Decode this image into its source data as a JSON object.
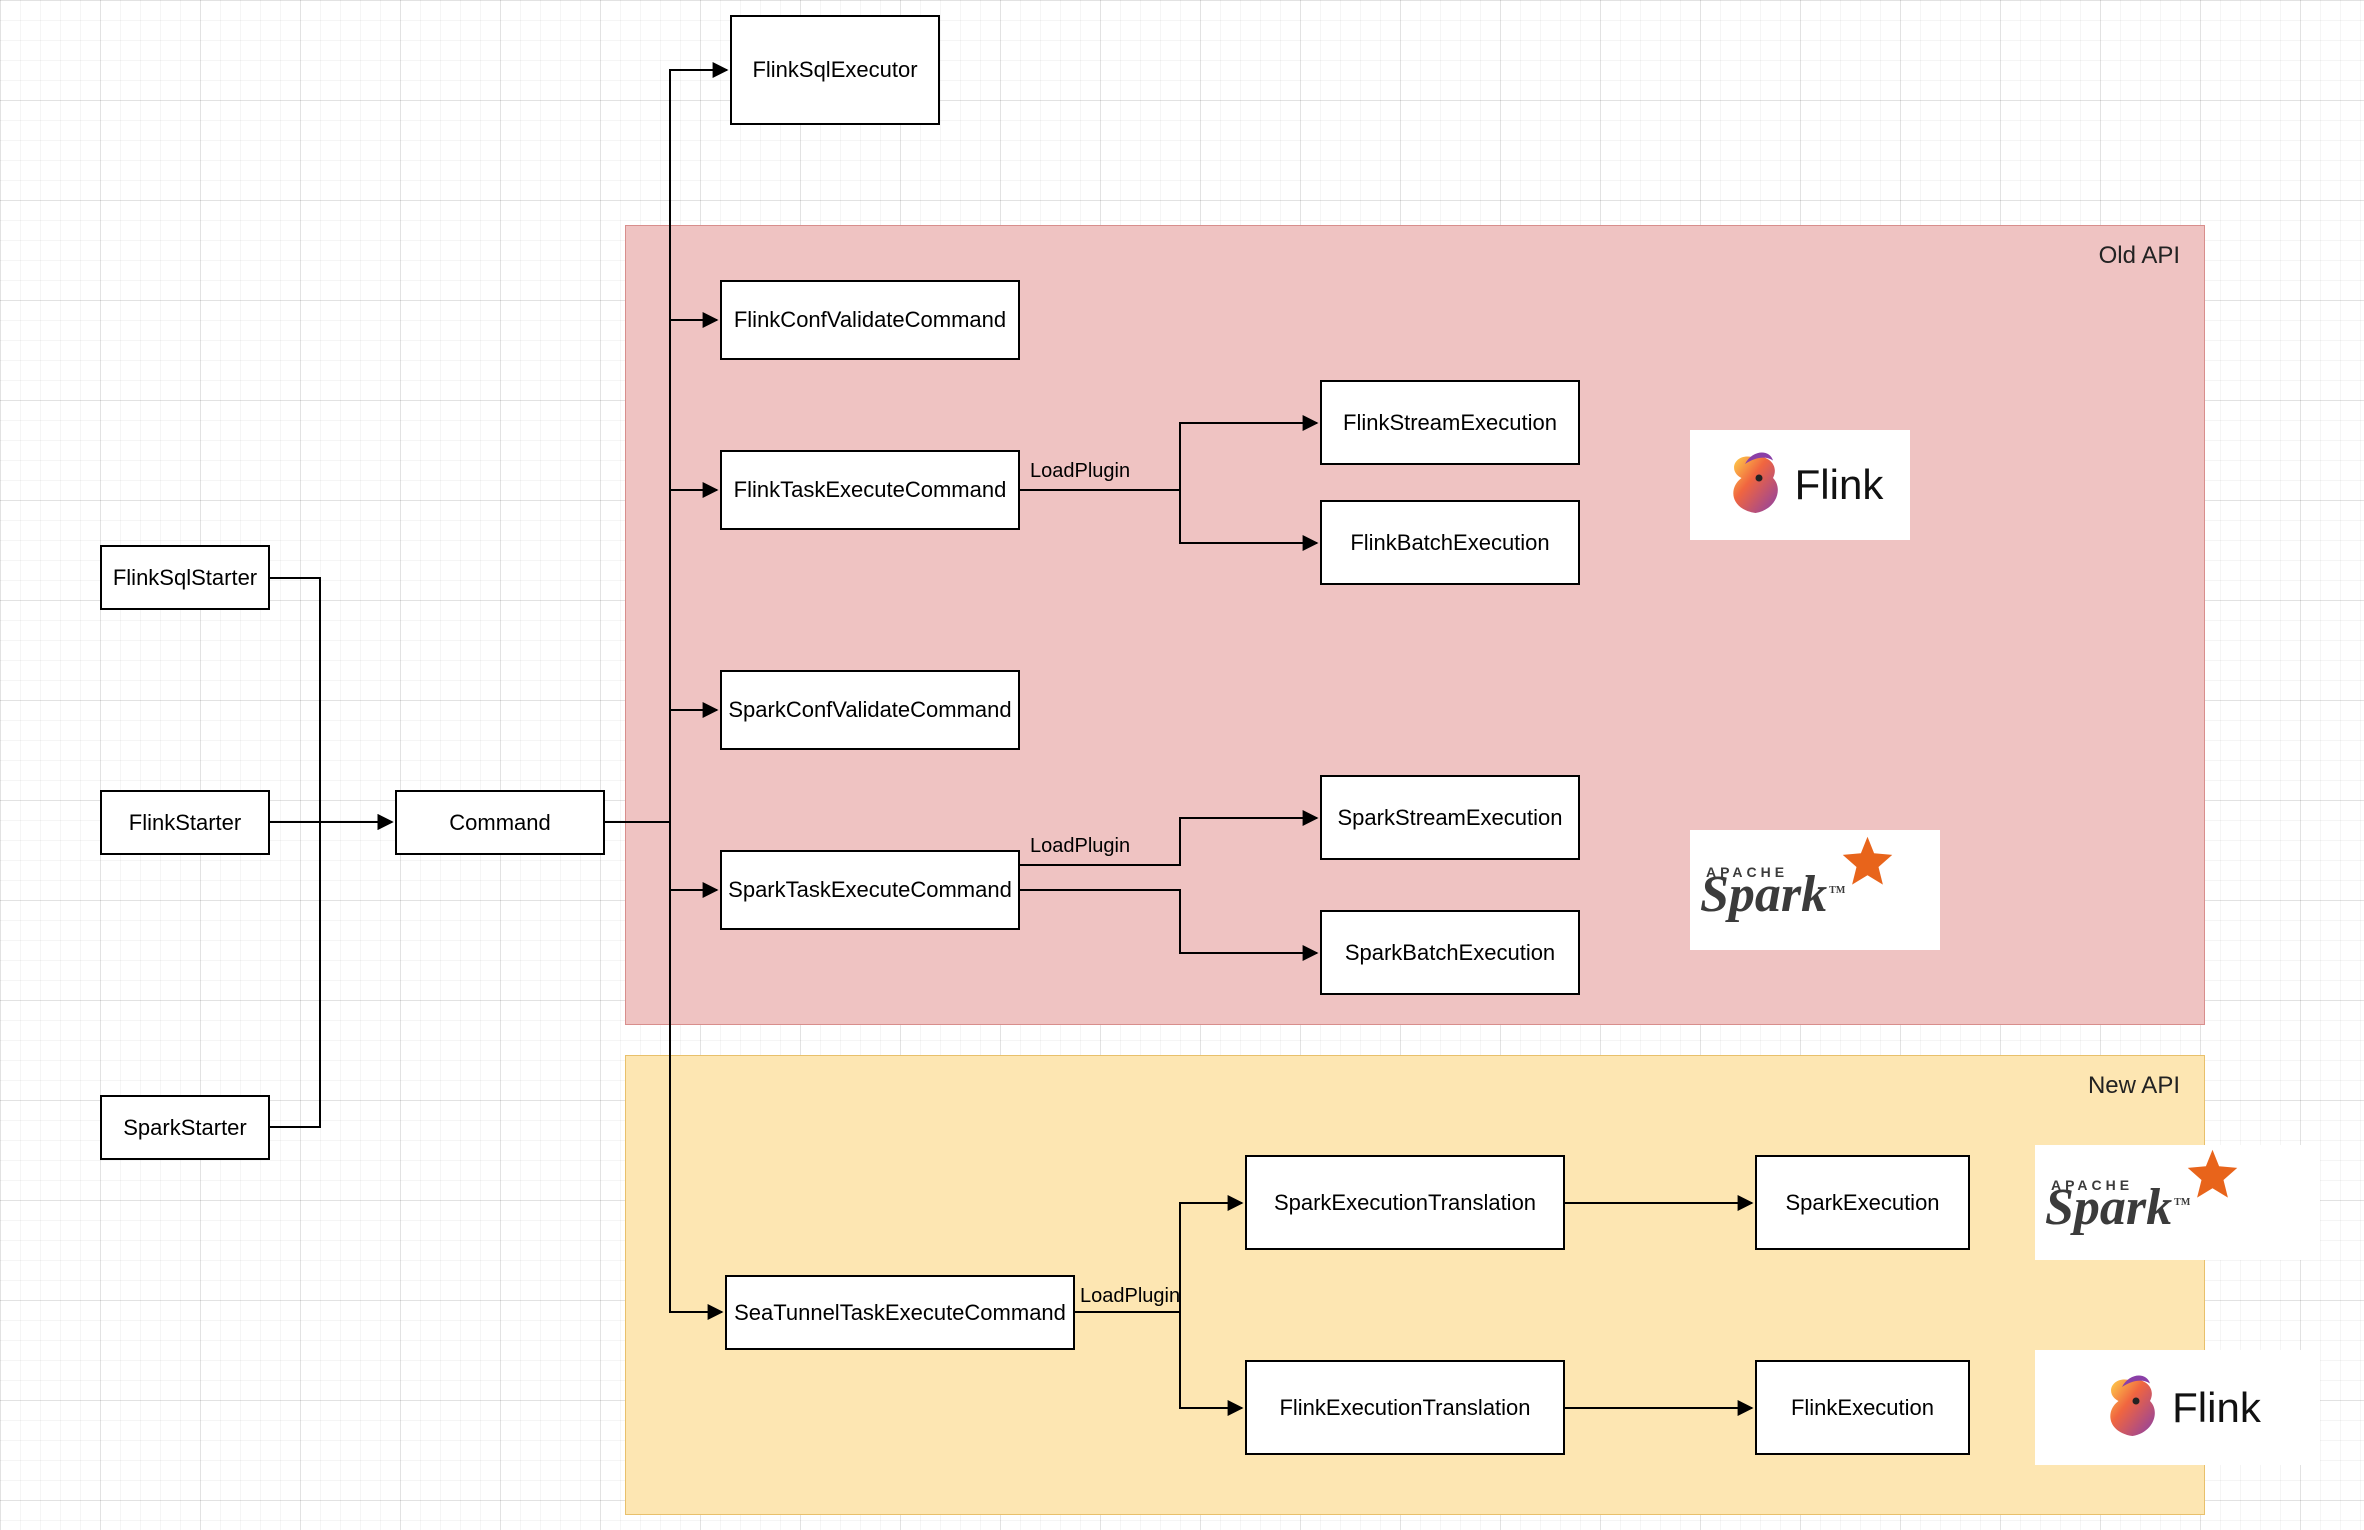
{
  "regions": {
    "old_api": {
      "label": "Old API",
      "bg": "#efc3c2",
      "border": "#d88e8c"
    },
    "new_api": {
      "label": "New API",
      "bg": "#fde6b2",
      "border": "#e8c06b"
    }
  },
  "nodes": {
    "flinkSqlStarter": "FlinkSqlStarter",
    "flinkStarter": "FlinkStarter",
    "sparkStarter": "SparkStarter",
    "command": "Command",
    "flinkSqlExecutor": "FlinkSqlExecutor",
    "flinkConfValidateCommand": "FlinkConfValidateCommand",
    "flinkTaskExecuteCommand": "FlinkTaskExecuteCommand",
    "sparkConfValidateCommand": "SparkConfValidateCommand",
    "sparkTaskExecuteCommand": "SparkTaskExecuteCommand",
    "flinkStreamExecution": "FlinkStreamExecution",
    "flinkBatchExecution": "FlinkBatchExecution",
    "sparkStreamExecution": "SparkStreamExecution",
    "sparkBatchExecution": "SparkBatchExecution",
    "seaTunnelTaskExecuteCommand": "SeaTunnelTaskExecuteCommand",
    "sparkExecutionTranslation": "SparkExecutionTranslation",
    "flinkExecutionTranslation": "FlinkExecutionTranslation",
    "sparkExecution": "SparkExecution",
    "flinkExecution": "FlinkExecution"
  },
  "edgeLabels": {
    "loadPlugin1": "LoadPlugin",
    "loadPlugin2": "LoadPlugin",
    "loadPlugin3": "LoadPlugin"
  },
  "logos": {
    "flink": "Flink",
    "sparkBrand": "Spark",
    "sparkApache": "APACHE",
    "sparkTm": "TM"
  }
}
